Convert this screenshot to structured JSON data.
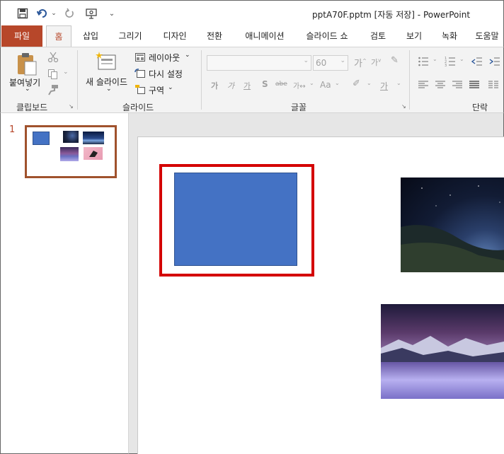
{
  "window": {
    "title": "pptA70F.pptm [자동 저장]  -  PowerPoint"
  },
  "quick_access": {
    "icons": [
      "save-icon",
      "undo-icon",
      "redo-icon",
      "present-icon",
      "customize-icon"
    ]
  },
  "tabs": [
    {
      "label": "파일"
    },
    {
      "label": "홈"
    },
    {
      "label": "삽입"
    },
    {
      "label": "그리기"
    },
    {
      "label": "디자인"
    },
    {
      "label": "전환"
    },
    {
      "label": "애니메이션"
    },
    {
      "label": "슬라이드 쇼"
    },
    {
      "label": "검토"
    },
    {
      "label": "보기"
    },
    {
      "label": "녹화"
    },
    {
      "label": "도움말"
    }
  ],
  "ribbon": {
    "clipboard": {
      "paste_label": "붙여넣기",
      "group_label": "클립보드"
    },
    "slides": {
      "new_slide_label": "새 슬라이드",
      "layout_label": "레이아웃",
      "reset_label": "다시 설정",
      "section_label": "구역",
      "group_label": "슬라이드"
    },
    "font": {
      "font_name_value": "",
      "font_size_value": "60",
      "group_label": "글꼴"
    },
    "paragraph": {
      "group_label": "단락"
    }
  },
  "thumbnails": [
    {
      "number": "1"
    }
  ],
  "colors": {
    "accent": "#b7472a",
    "shape_fill": "#4472c4",
    "selection": "#d40000"
  }
}
